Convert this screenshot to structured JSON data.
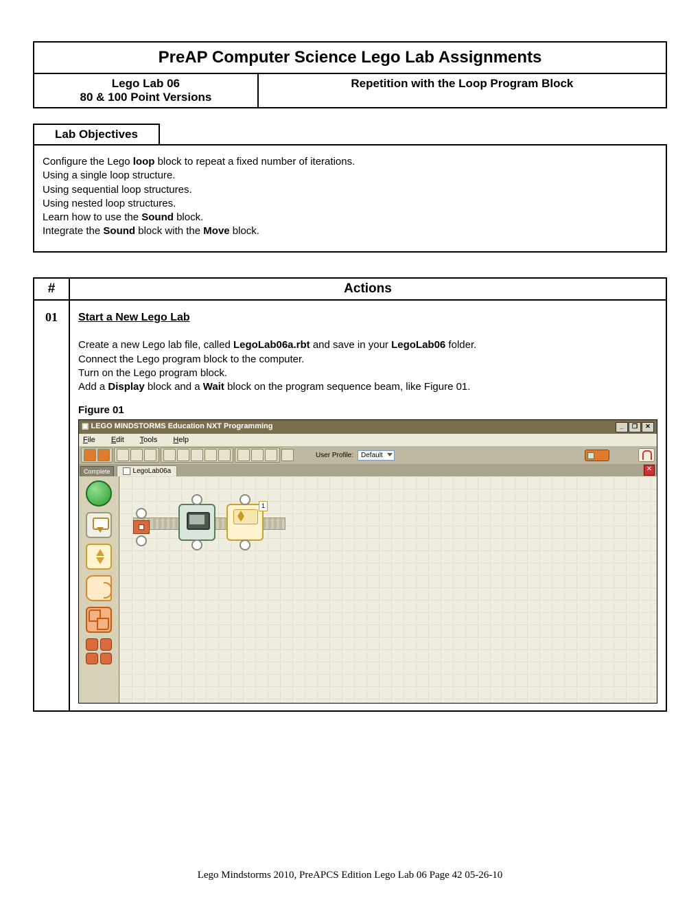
{
  "header": {
    "title": "PreAP Computer Science Lego Lab Assignments",
    "left_line1": "Lego Lab 06",
    "left_line2": "80 & 100 Point Versions",
    "right": "Repetition with the Loop Program Block"
  },
  "objectives": {
    "tab": "Lab Objectives",
    "lines": {
      "l1a": "Configure the Lego ",
      "l1b": "loop",
      "l1c": " block to repeat a fixed number of iterations.",
      "l2": "Using a single loop structure.",
      "l3": "Using sequential loop structures.",
      "l4": "Using nested loop structures.",
      "l5a": "Learn how to use the ",
      "l5b": "Sound",
      "l5c": " block.",
      "l6a": "Integrate the ",
      "l6b": "Sound",
      "l6c": " block with the ",
      "l6d": "Move",
      "l6e": " block."
    }
  },
  "table": {
    "col1": "#",
    "col2": "Actions",
    "row1": {
      "num": "01",
      "title": "Start a New Lego Lab",
      "p1a": "Create a new Lego lab file, called ",
      "p1b": "LegoLab06a.rbt",
      "p1c": " and save in your ",
      "p1d": "LegoLab06",
      "p1e": " folder.",
      "p2": "Connect the Lego program block to the computer.",
      "p3": "Turn on the Lego program block.",
      "p4a": "Add a ",
      "p4b": "Display",
      "p4c": " block and a ",
      "p4d": "Wait",
      "p4e": " block on the program sequence beam, like Figure 01.",
      "fig": "Figure 01"
    }
  },
  "screenshot": {
    "title": "LEGO MINDSTORMS Education NXT Programming",
    "win_min": "_",
    "win_max": "❐",
    "win_close": "✕",
    "menu": {
      "file": "File",
      "edit": "Edit",
      "tools": "Tools",
      "help": "Help"
    },
    "profile_label": "User Profile:",
    "profile_value": "Default",
    "side_label": "Complete",
    "tab_name": "LegoLab06a",
    "close_x": "✕",
    "wait_num": "1"
  },
  "footer": {
    "text": "Lego Mindstorms 2010, PreAPCS Edition    Lego Lab 06    Page 42    05-26-10"
  }
}
